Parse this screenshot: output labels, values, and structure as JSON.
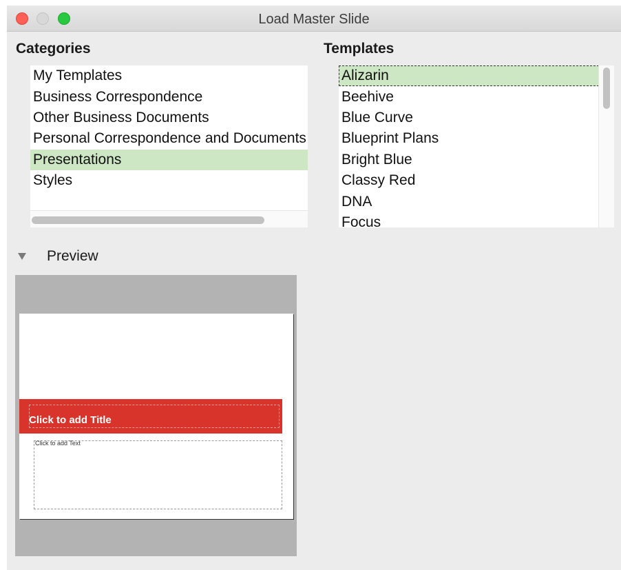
{
  "window": {
    "title": "Load Master Slide"
  },
  "categories": {
    "label": "Categories",
    "items": [
      "My Templates",
      "Business Correspondence",
      "Other Business Documents",
      "Personal Correspondence and Documents",
      "Presentations",
      "Styles"
    ],
    "selected": "Presentations"
  },
  "templates": {
    "label": "Templates",
    "items": [
      "Alizarin",
      "Beehive",
      "Blue Curve",
      "Blueprint Plans",
      "Bright Blue",
      "Classy Red",
      "DNA",
      "Focus"
    ],
    "selected": "Alizarin"
  },
  "preview": {
    "label": "Preview",
    "slide": {
      "title_placeholder": "Click to add Title",
      "text_placeholder": "Click to add Text",
      "accent_color": "#d9342b"
    }
  },
  "colors": {
    "selection": "#cde6c4",
    "window_bg": "#ececec"
  }
}
